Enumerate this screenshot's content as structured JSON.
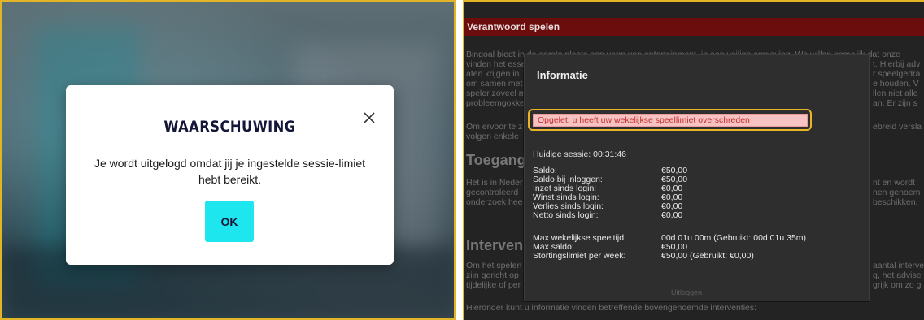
{
  "left_modal": {
    "title": "WAARSCHUWING",
    "message": "Je wordt uitgelogd omdat jij je ingestelde sessie-limiet hebt bereikt.",
    "ok_label": "OK"
  },
  "right_page": {
    "header_title": "Verantwoord spelen",
    "background_paragraphs": [
      "Bingoal biedt in de eerste plaats een vorm van entertainment, in een veilige omgeving. We willen namelijk dat onze",
      "vinden het esse",
      "aten krijgen in",
      "om samen met",
      "speler zoveel m",
      "probleemgokke",
      "Om ervoor te z",
      "volgen enkele",
      "Het is in Neder",
      "gecontroleerd",
      "onderzoek hee",
      "Om het spelen",
      "zijn gericht op",
      "tijdelijke of per",
      "Hieronder kunt u informatie vinden betreffende bovengenoemde interventies:"
    ],
    "background_fragments_right": [
      "t. Hierbij adv",
      "r speelgedra",
      "e houden. V",
      "llen niet alle",
      "an. Er zijn s",
      "ebreid versla",
      "nt en wordt",
      "nen genoem",
      "beschikken.",
      "aantal interve",
      "g, het advise",
      "grijk om zo g"
    ],
    "background_headings": [
      "Toegang",
      "Interven"
    ]
  },
  "info_dialog": {
    "title": "Informatie",
    "alert": "Opgelet: u heeft uw wekelijkse speellimiet overschreden",
    "session": "Huidige sessie: 00:31:46",
    "rows_balance": [
      {
        "label": "Saldo:",
        "value": "€50,00"
      },
      {
        "label": "Saldo bij inloggen:",
        "value": "€50,00"
      },
      {
        "label": "Inzet sinds login:",
        "value": "€0,00"
      },
      {
        "label": "Winst sinds login:",
        "value": "€0,00"
      },
      {
        "label": "Verlies sinds login:",
        "value": "€0,00"
      },
      {
        "label": "Netto sinds login:",
        "value": "€0,00"
      }
    ],
    "rows_limits": [
      {
        "label": "Max wekelijkse speeltijd:",
        "value": "00d 01u 00m (Gebruikt: 00d 01u 35m)"
      },
      {
        "label": "Max saldo:",
        "value": "€50,00"
      },
      {
        "label": "Stortingslimiet per week:",
        "value": "€50,00 (Gebruikt: €0,00)"
      }
    ],
    "logout_label": "Uitloggen"
  }
}
